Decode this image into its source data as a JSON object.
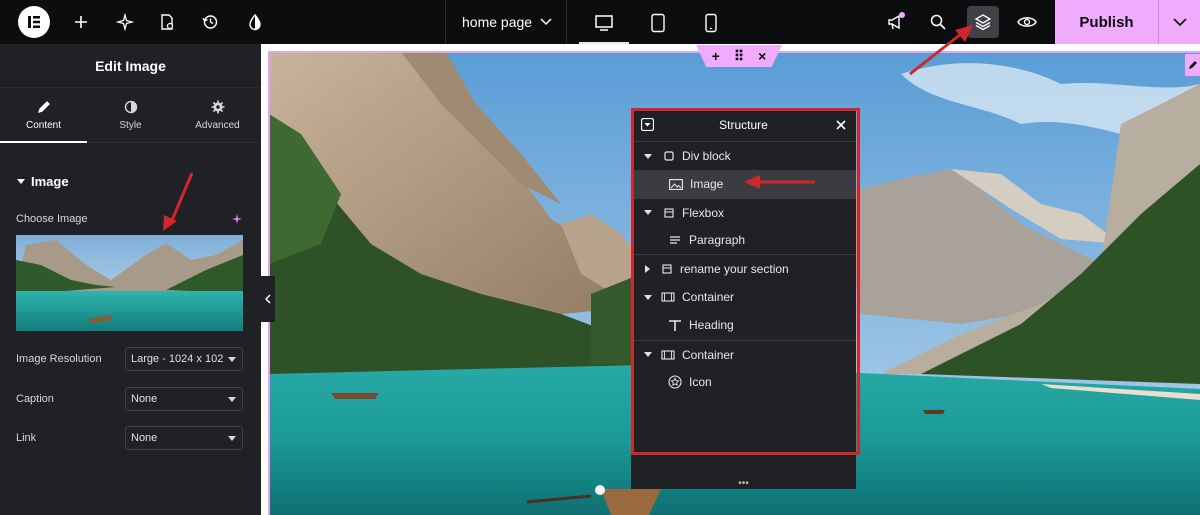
{
  "topbar": {
    "page_name": "home page",
    "publish_label": "Publish"
  },
  "panel": {
    "title": "Edit Image",
    "tabs": [
      {
        "label": "Content",
        "icon": "pencil-icon"
      },
      {
        "label": "Style",
        "icon": "half-circle-icon"
      },
      {
        "label": "Advanced",
        "icon": "gear-icon"
      }
    ],
    "section_title": "Image",
    "choose_image_label": "Choose Image",
    "fields": [
      {
        "label": "Image Resolution",
        "value": "Large - 1024 x 102"
      },
      {
        "label": "Caption",
        "value": "None"
      },
      {
        "label": "Link",
        "value": "None"
      }
    ]
  },
  "handle": {
    "add": "+",
    "move": "⠿",
    "close": "×"
  },
  "structure": {
    "title": "Structure",
    "items": [
      {
        "label": "Div block",
        "icon": "square-icon",
        "level": 0,
        "expanded": true
      },
      {
        "label": "Image",
        "icon": "image-icon",
        "level": 1,
        "selected": true
      },
      {
        "label": "Flexbox",
        "icon": "flexbox-icon",
        "level": 0,
        "expanded": true
      },
      {
        "label": "Paragraph",
        "icon": "paragraph-icon",
        "level": 1
      },
      {
        "label": "rename your section",
        "icon": "section-icon",
        "level": 0,
        "expanded": false
      },
      {
        "label": "Container",
        "icon": "container-icon",
        "level": 0,
        "expanded": true
      },
      {
        "label": "Heading",
        "icon": "heading-icon",
        "level": 1
      },
      {
        "label": "Container",
        "icon": "container-icon",
        "level": 0,
        "expanded": true
      },
      {
        "label": "Icon",
        "icon": "star-circle-icon",
        "level": 1
      }
    ]
  },
  "colors": {
    "accent": "#f0abfc",
    "annotation_red": "#d1262b",
    "panel_bg": "#1f2124",
    "topbar_bg": "#0c0d0e"
  }
}
